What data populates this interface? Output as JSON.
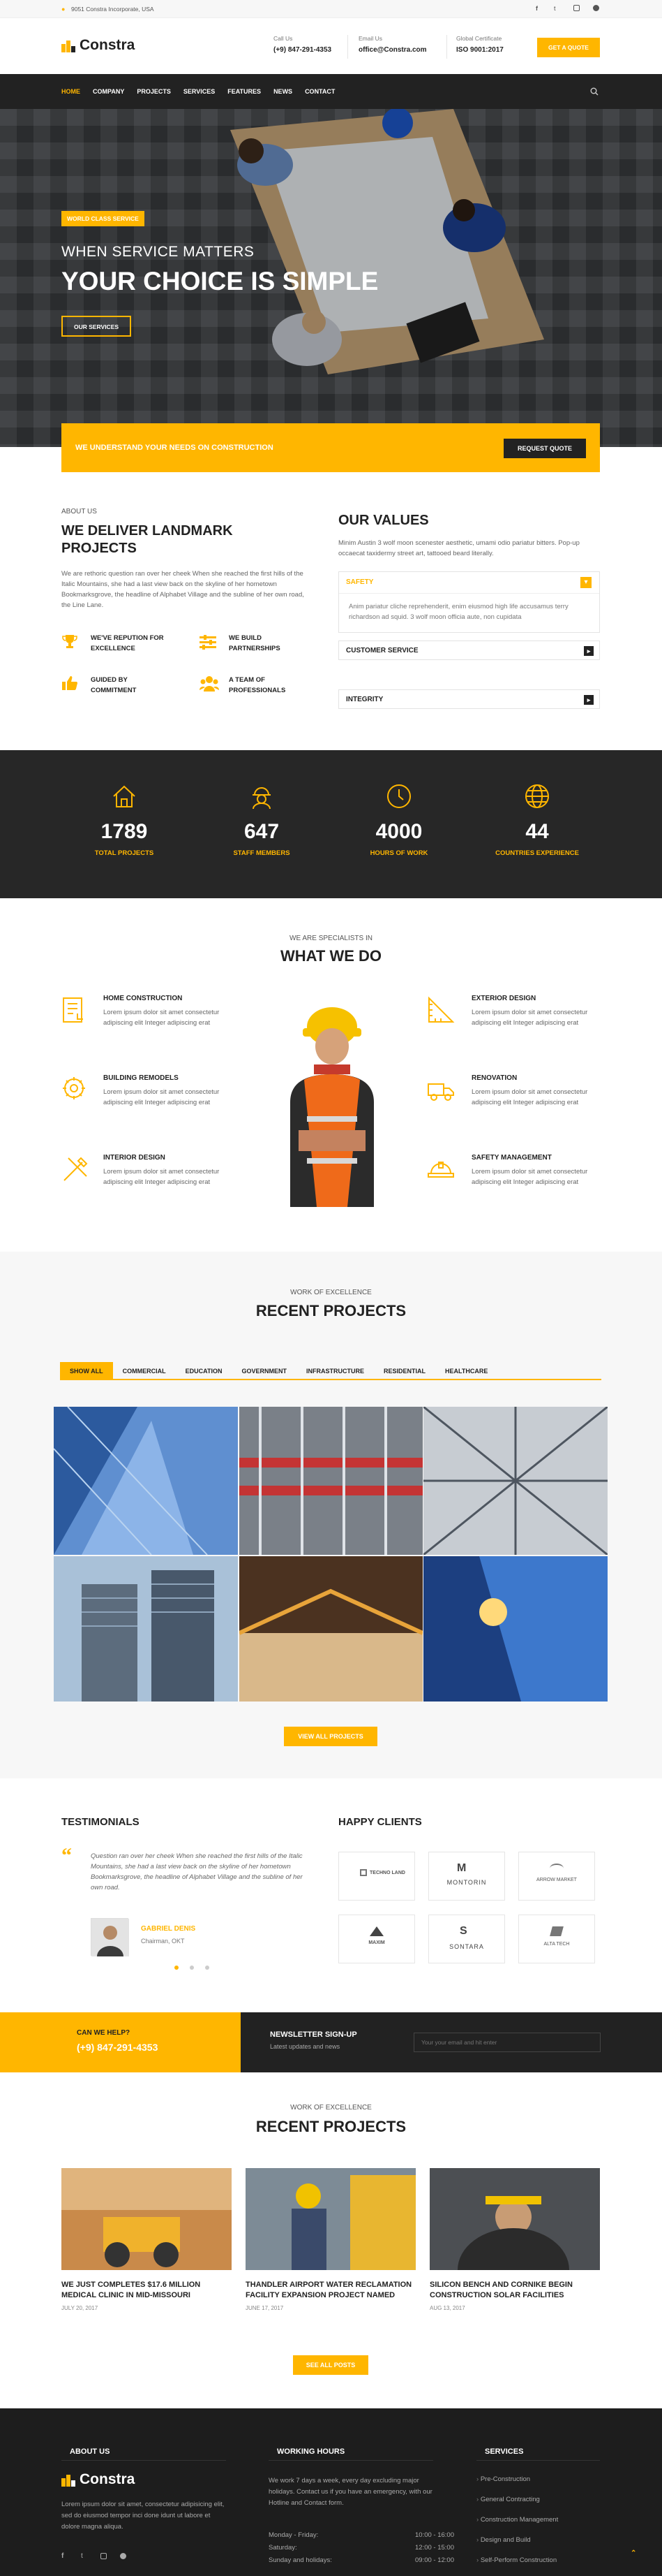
{
  "topbar": {
    "address": "9051 Constra Incorporate, USA",
    "social": [
      "facebook-icon",
      "twitter-icon",
      "instagram-icon",
      "github-icon"
    ]
  },
  "header": {
    "logo_text": "Constra",
    "call_label": "Call Us",
    "call_value": "(+9) 847-291-4353",
    "email_label": "Email Us",
    "email_value": "office@Constra.com",
    "cert_label": "Global Certificate",
    "cert_value": "ISO 9001:2017",
    "quote_button": "Get A Quote"
  },
  "nav": {
    "items": [
      "HOME",
      "COMPANY",
      "PROJECTS",
      "SERVICES",
      "FEATURES",
      "NEWS",
      "CONTACT"
    ],
    "active": "HOME"
  },
  "hero": {
    "tag": "WORLD CLASS SERVICE",
    "subtitle": "WHEN SERVICE MATTERS",
    "title": "YOUR CHOICE IS SIMPLE",
    "button": "OUR SERVICES"
  },
  "cta_bar": {
    "text": "WE UNDERSTAND YOUR NEEDS ON CONSTRUCTION",
    "button": "REQUEST QUOTE"
  },
  "about": {
    "kicker": "ABOUT US",
    "title": "WE DELIVER LANDMARK PROJECTS",
    "text": "We are rethoric question ran over her cheek When she reached the first hills of the Italic Mountains, she had a last view back on the skyline of her hometown Bookmarksgrove, the headline of Alphabet Village and the subline of her own road, the Line Lane.",
    "features": [
      {
        "icon": "trophy-icon",
        "label": "WE'VE REPUTION FOR EXCELLENCE"
      },
      {
        "icon": "sliders-icon",
        "label": "WE BUILD PARTNERSHIPS"
      },
      {
        "icon": "thumbs-up-icon",
        "label": "GUIDED BY COMMITMENT"
      },
      {
        "icon": "team-icon",
        "label": "A TEAM OF PROFESSIONALS"
      }
    ]
  },
  "values": {
    "title": "OUR VALUES",
    "text": "Minim Austin 3 wolf moon scenester aesthetic, umami odio pariatur bitters. Pop-up occaecat taxidermy street art, tattooed beard literally.",
    "accordion": [
      {
        "label": "SAFETY",
        "open": true,
        "body": "Anim pariatur cliche reprehenderit, enim eiusmod high life accusamus terry richardson ad squid. 3 wolf moon officia aute, non cupidata"
      },
      {
        "label": "CUSTOMER SERVICE",
        "open": false,
        "body": ""
      },
      {
        "label": "INTEGRITY",
        "open": false,
        "body": ""
      }
    ]
  },
  "facts": [
    {
      "icon": "house-icon",
      "value": "1789",
      "label": "TOTAL PROJECTS"
    },
    {
      "icon": "worker-icon",
      "value": "647",
      "label": "STAFF MEMBERS"
    },
    {
      "icon": "clock-icon",
      "value": "4000",
      "label": "HOURS OF WORK"
    },
    {
      "icon": "globe-icon",
      "value": "44",
      "label": "COUNTRIES EXPERIENCE"
    }
  ],
  "services": {
    "kicker": "WE ARE SPECIALISTS IN",
    "title": "WHAT WE DO",
    "left": [
      {
        "icon": "blueprint-icon",
        "title": "HOME CONSTRUCTION",
        "text": "Lorem ipsum dolor sit amet consectetur adipiscing elit Integer adipiscing erat"
      },
      {
        "icon": "gear-head-icon",
        "title": "BUILDING REMODELS",
        "text": "Lorem ipsum dolor sit amet consectetur adipiscing elit Integer adipiscing erat"
      },
      {
        "icon": "tools-icon",
        "title": "INTERIOR DESIGN",
        "text": "Lorem ipsum dolor sit amet consectetur adipiscing elit Integer adipiscing erat"
      }
    ],
    "right": [
      {
        "icon": "ruler-icon",
        "title": "EXTERIOR DESIGN",
        "text": "Lorem ipsum dolor sit amet consectetur adipiscing elit Integer adipiscing erat"
      },
      {
        "icon": "truck-icon",
        "title": "RENOVATION",
        "text": "Lorem ipsum dolor sit amet consectetur adipiscing elit Integer adipiscing erat"
      },
      {
        "icon": "helmet-icon",
        "title": "SAFETY MANAGEMENT",
        "text": "Lorem ipsum dolor sit amet consectetur adipiscing elit Integer adipiscing erat"
      }
    ]
  },
  "projects": {
    "kicker": "WORK OF EXCELLENCE",
    "title": "RECENT PROJECTS",
    "tabs": [
      "SHOW ALL",
      "COMMERCIAL",
      "EDUCATION",
      "GOVERNMENT",
      "INFRASTRUCTURE",
      "RESIDENTIAL",
      "HEALTHCARE"
    ],
    "active_tab": "SHOW ALL",
    "button": "VIEW ALL PROJECTS"
  },
  "testimonials": {
    "title": "TESTIMONIALS",
    "quote": "Question ran over her cheek When she reached the first hills of the Italic Mountains, she had a last view back on the skyline of her hometown Bookmarksgrove, the headline of Alphabet Village and the subline of her own road.",
    "name": "GABRIEL DENIS",
    "role": "Chairman, OKT"
  },
  "clients": {
    "title": "HAPPY CLIENTS",
    "logos": [
      "TECHNO LAND",
      "MONTORIN",
      "ARROW MARKET",
      "MAXIM",
      "SONTARA",
      "ALTA TECH"
    ]
  },
  "help": {
    "label": "CAN WE HELP?",
    "phone": "(+9) 847-291-4353"
  },
  "newsletter": {
    "title": "NEWSLETTER SIGN-UP",
    "subtitle": "Latest updates and news",
    "placeholder": "Your your email and hit enter"
  },
  "news": {
    "kicker": "WORK OF EXCELLENCE",
    "title": "RECENT PROJECTS",
    "items": [
      {
        "title": "WE JUST COMPLETES $17.6 MILLION MEDICAL CLINIC IN MID-MISSOURI",
        "date": "JULY 20, 2017"
      },
      {
        "title": "THANDLER AIRPORT WATER RECLAMATION FACILITY EXPANSION PROJECT NAMED",
        "date": "JUNE 17, 2017"
      },
      {
        "title": "SILICON BENCH AND CORNIKE BEGIN CONSTRUCTION SOLAR FACILITIES",
        "date": "AUG 13, 2017"
      }
    ],
    "button": "SEE ALL POSTS"
  },
  "footer": {
    "about_title": "ABOUT US",
    "logo_text": "Constra",
    "about_text": "Lorem ipsum dolor sit amet, consectetur adipisicing elit, sed do eiusmod tempor inci done idunt ut labore et dolore magna aliqua.",
    "hours_title": "WORKING HOURS",
    "hours_text": "We work 7 days a week, every day excluding major holidays. Contact us if you have an emergency, with our Hotline and Contact form.",
    "hours": [
      {
        "day": "Monday - Friday:",
        "time": "10:00 - 16:00"
      },
      {
        "day": "Saturday:",
        "time": "12:00 - 15:00"
      },
      {
        "day": "Sunday and holidays:",
        "time": "09:00 - 12:00"
      }
    ],
    "services_title": "SERVICES",
    "services": [
      "Pre-Construction",
      "General Contracting",
      "Construction Management",
      "Design and Build",
      "Self-Perform Construction"
    ]
  },
  "colors": {
    "accent": "#ffb600",
    "dark": "#2b2b2b",
    "footer": "#1d1d1d"
  }
}
